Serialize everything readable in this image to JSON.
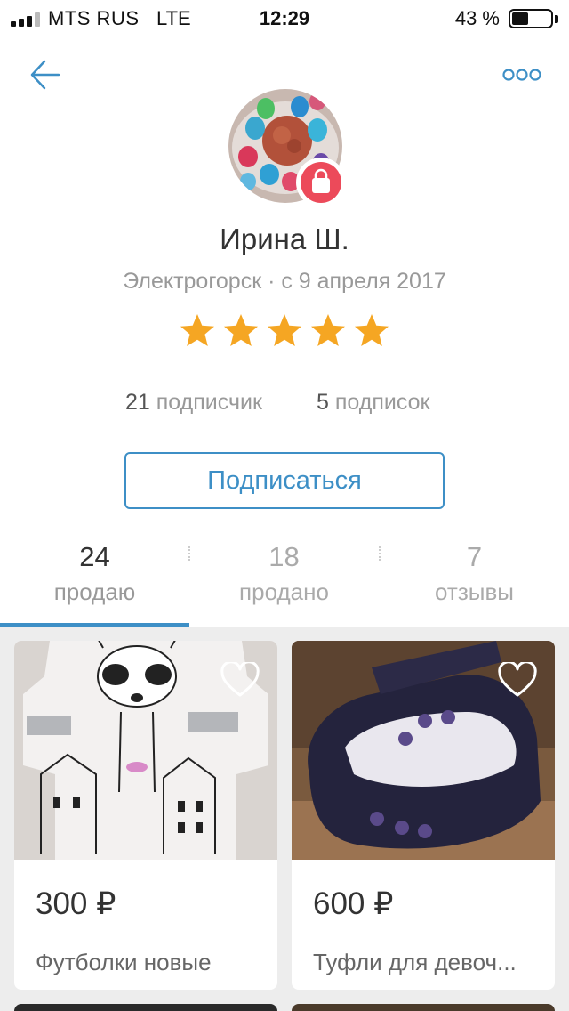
{
  "status_bar": {
    "carrier": "MTS RUS",
    "network": "LTE",
    "time": "12:29",
    "battery": "43 %",
    "battery_level": 0.43,
    "signal_bars": 3
  },
  "nav": {
    "back_icon": "arrow-left-icon",
    "more_icon": "more-dots-icon"
  },
  "profile": {
    "avatar_icon": "avatar-photo",
    "badge_icon": "shopping-bag-icon",
    "name": "Ирина Ш.",
    "meta": "Электрогорск · с 9 апреля 2017",
    "rating": 5,
    "rating_max": 5,
    "followers": {
      "count": "21",
      "label": "подписчик"
    },
    "following": {
      "count": "5",
      "label": "подписок"
    },
    "subscribe_label": "Подписаться"
  },
  "tabs": [
    {
      "count": "24",
      "label": "продаю",
      "active": true
    },
    {
      "count": "18",
      "label": "продано",
      "active": false
    },
    {
      "count": "7",
      "label": "отзывы",
      "active": false
    }
  ],
  "products": [
    {
      "price": "300 ₽",
      "title": "Футболки новые"
    },
    {
      "price": "600 ₽",
      "title": "Туфли для девоч..."
    }
  ],
  "colors": {
    "accent": "#3d8fc6",
    "star": "#f5a623",
    "badge": "#ec4a5a"
  }
}
